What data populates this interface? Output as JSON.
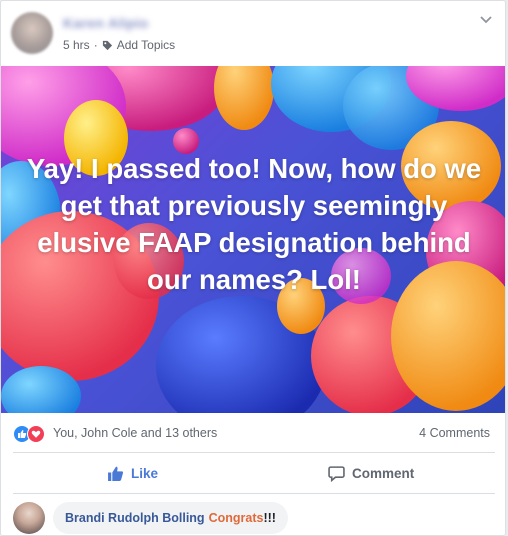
{
  "post": {
    "author_name": "Karen Alipio",
    "time": "5 hrs",
    "separator": "·",
    "add_topics": "Add Topics",
    "image_text": "Yay! I passed too! Now, how do we get that previously seemingly elusive FAAP designation behind our names? Lol!"
  },
  "reactions": {
    "summary": "You, John Cole and 13 others",
    "comments_count": "4 Comments"
  },
  "actions": {
    "like_label": "Like",
    "comment_label": "Comment"
  },
  "comment": {
    "commenter_name": "Brandi Rudolph Bolling",
    "text_part1": "Congrats",
    "text_part2": "!!!"
  },
  "colors": {
    "link_blue": "#385898",
    "like_blue": "#4a7ad6",
    "love_red": "#f33e58",
    "orange_text": "#e0693a"
  }
}
